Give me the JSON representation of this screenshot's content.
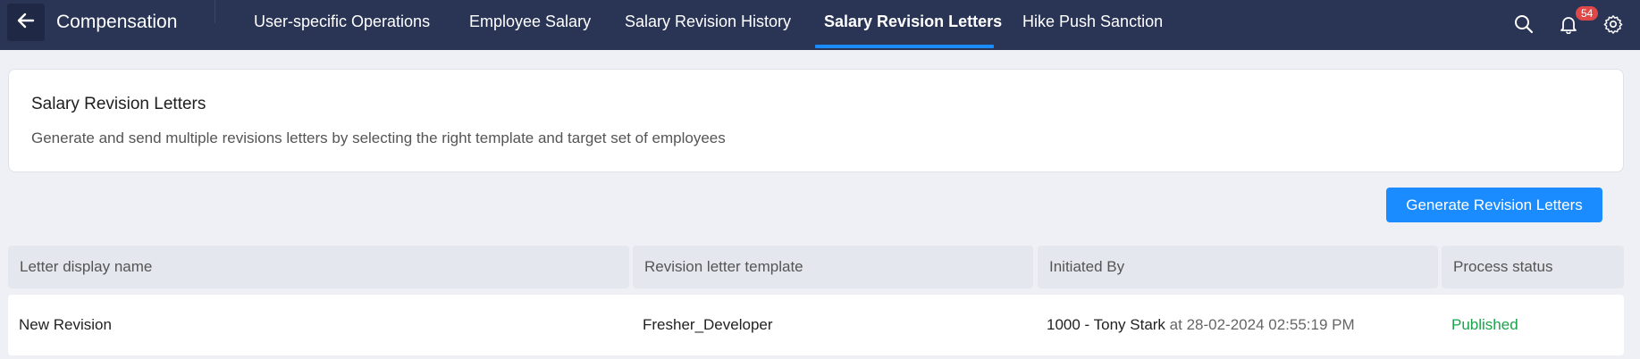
{
  "header": {
    "title": "Compensation",
    "tabs": [
      {
        "label": "User-specific Operations"
      },
      {
        "label": "Employee Salary"
      },
      {
        "label": "Salary Revision History"
      },
      {
        "label": "Salary Revision Letters"
      },
      {
        "label": "Hike Push Sanction"
      }
    ],
    "active_tab": "Salary Revision Letters",
    "icons": [
      "back-arrow-icon",
      "search-icon",
      "bell-icon",
      "gear-icon"
    ],
    "notification_count": "54"
  },
  "info": {
    "title": "Salary Revision Letters",
    "description": "Generate and send multiple revisions letters by selecting the right template and target set of employees"
  },
  "actions": {
    "generate_label": "Generate Revision Letters"
  },
  "table": {
    "headers": [
      "Letter display name",
      "Revision letter template",
      "Initiated By",
      "Process status"
    ],
    "rows": [
      {
        "name": "New Revision",
        "template": "Fresher_Developer",
        "initiator": "1000 - Tony Stark",
        "initiated_at": "at 28-02-2024 02:55:19 PM",
        "status": "Published"
      }
    ]
  },
  "colors": {
    "header_bg": "#2a3556",
    "accent": "#1a8cff",
    "badge": "#e04848",
    "status_published": "#19a34a"
  }
}
